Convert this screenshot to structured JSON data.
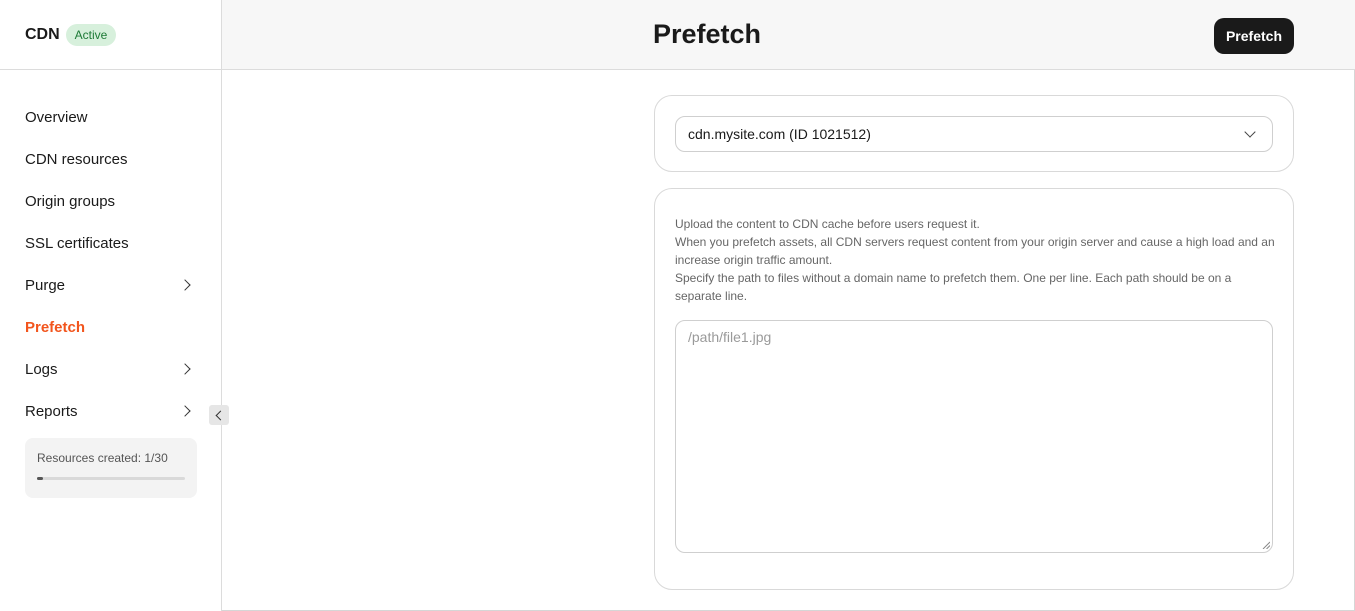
{
  "sidebar": {
    "brand": "CDN",
    "status_badge": "Active",
    "items": [
      {
        "label": "Overview"
      },
      {
        "label": "CDN resources"
      },
      {
        "label": "Origin groups"
      },
      {
        "label": "SSL certificates"
      },
      {
        "label": "Purge"
      },
      {
        "label": "Prefetch"
      },
      {
        "label": "Logs"
      },
      {
        "label": "Reports"
      }
    ],
    "quota": {
      "label": "Resources created: 1/30",
      "used": 1,
      "total": 30
    }
  },
  "header": {
    "title": "Prefetch",
    "action_label": "Prefetch"
  },
  "main": {
    "resource_select": {
      "value": "cdn.mysite.com (ID 1021512)"
    },
    "description": [
      "Upload the content to CDN cache before users request it.",
      "When you prefetch assets, all CDN servers request content from your origin server and cause a high load and an increase origin traffic amount.",
      "Specify the path to files without a domain name to prefetch them. One per line. Each path should be on a separate line."
    ],
    "paths_input": {
      "placeholder": "/path/file1.jpg",
      "value": ""
    }
  },
  "colors": {
    "accent": "#f2551d",
    "badge_bg": "#d7f0dc",
    "badge_text": "#1d7a36",
    "primary_button": "#1a1a1a"
  },
  "icons": {
    "nav_expand": "chevron-right-icon",
    "sidebar_collapse": "chevron-left-icon",
    "select_open": "chevron-down-icon"
  }
}
